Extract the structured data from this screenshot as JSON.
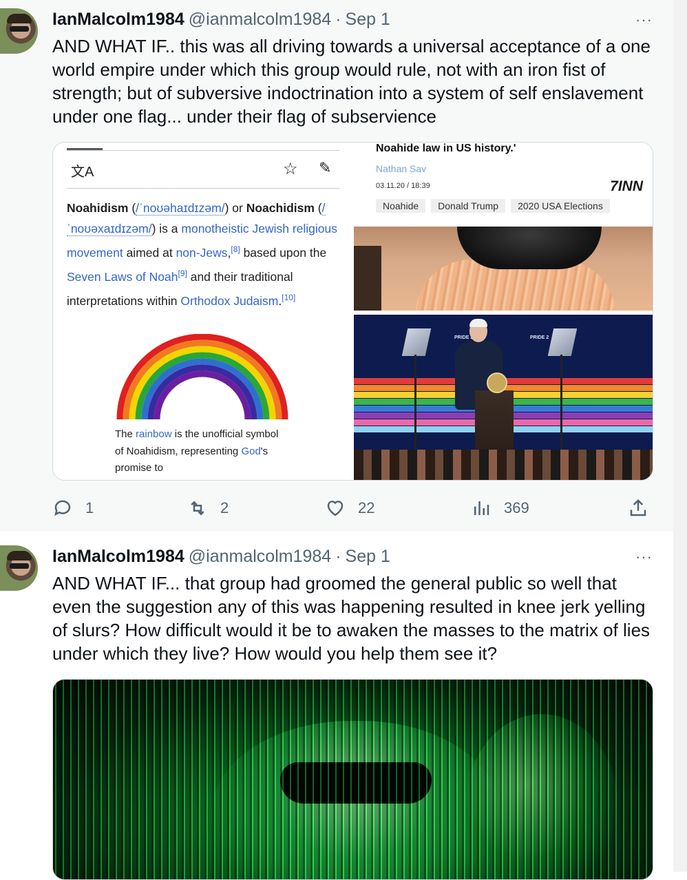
{
  "tweets": [
    {
      "author_name": "IanMalcolm1984",
      "handle": "@ianmalcolm1984",
      "separator": "·",
      "date": "Sep 1",
      "more": "···",
      "text": "AND WHAT IF.. this was all driving towards a universal acceptance of a one world empire under which this group would rule, not with an iron fist of strength; but of subversive indoctrination into a system of self enslavement under one flag... under their flag of subservience",
      "embedded_wiki": {
        "translate_icon": "文A",
        "term1": "Noahidism",
        "ipa1": "/ˈnoʊəhaɪdɪzəm/",
        "or": "or",
        "term2": "Noachidism",
        "ipa2": "/ˈnoʊəxaɪdɪzəm/",
        "is_a": "is a",
        "link_monotheistic": "monotheistic Jewish religious movement",
        "aimed_at": "aimed at",
        "link_nonjews": "non-Jews",
        "ref8": "[8]",
        "based_upon": "based upon the",
        "link_seven_laws": "Seven Laws of Noah",
        "ref9": "[9]",
        "and_their": "and their traditional interpretations within",
        "link_orthodox": "Orthodox Judaism",
        "period": ".",
        "ref10": "[10]",
        "caption_the": "The",
        "caption_link_rainbow": "rainbow",
        "caption_mid": "is the unofficial symbol of Noahidism, representing",
        "caption_link_god": "God",
        "caption_end": "'s promise to"
      },
      "embedded_news": {
        "headline": "Noahide law in US history.'",
        "author": "Nathan Sav",
        "timestamp": "03.11.20 / 18:39",
        "logo": "7INN",
        "tags": [
          "Noahide",
          "Donald Trump",
          "2020 USA Elections"
        ],
        "stage_label_left": "PRIDE 2023",
        "stage_label_right": "PRIDE 2"
      },
      "stats": {
        "replies": "1",
        "retweets": "2",
        "likes": "22",
        "views": "369"
      },
      "colors": {
        "stripes": [
          "#e23a3a",
          "#f08a2a",
          "#f5d12f",
          "#3bb44a",
          "#3a7bd5",
          "#8a3fb5",
          "#e86aa8",
          "#8fd3f0"
        ]
      }
    },
    {
      "author_name": "IanMalcolm1984",
      "handle": "@ianmalcolm1984",
      "separator": "·",
      "date": "Sep 1",
      "more": "···",
      "text": "AND WHAT IF... that group had groomed the general public so well that even the suggestion any of this was happening resulted in knee jerk yelling of slurs? How difficult would it be to awaken the masses to the matrix of lies under which they live? How would you help them see it?"
    }
  ],
  "icons": {
    "reply": "reply-icon",
    "retweet": "retweet-icon",
    "like": "heart-icon",
    "views": "views-icon",
    "share": "share-icon",
    "star": "star-icon",
    "pencil": "pencil-icon",
    "translate": "translate-icon"
  }
}
